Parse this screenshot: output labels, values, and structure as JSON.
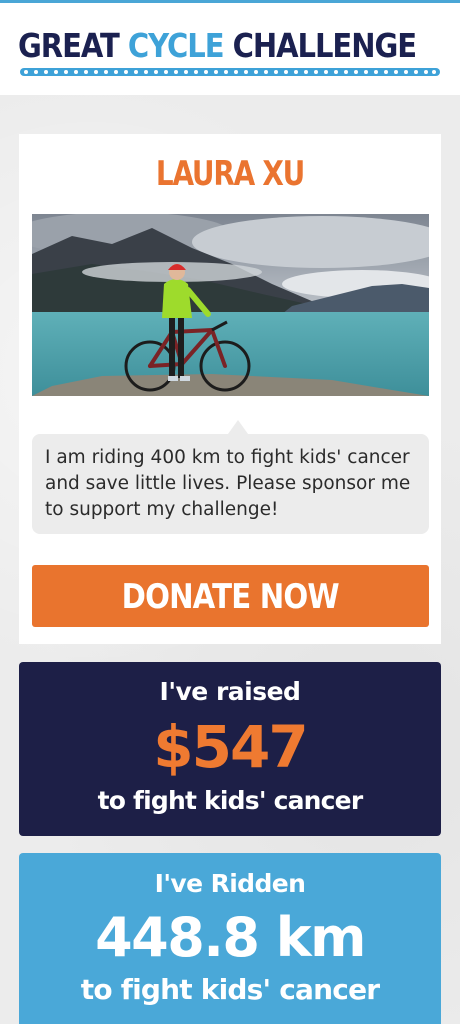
{
  "header": {
    "logo_word1": "GREAT",
    "logo_word2": "CYCLE",
    "logo_word3": "CHALLENGE",
    "logo_colors": {
      "navy": "#1b2150",
      "blue": "#3ea2d8"
    }
  },
  "profile": {
    "name": "LAURA XU",
    "photo_icon": "cyclist-photo",
    "message": "I am riding 400 km to fight kids' cancer and save little lives. Please sponsor me to support my challenge!",
    "donate_label": "DONATE NOW"
  },
  "raised": {
    "label": "I've raised",
    "amount": "$547",
    "caption": "to fight kids' cancer"
  },
  "ridden": {
    "label": "I've Ridden",
    "distance": "448.8 km",
    "caption": "to fight kids' cancer"
  },
  "colors": {
    "accent_orange": "#e9742e",
    "navy": "#1d1f47",
    "sky_blue": "#4aa8d8"
  }
}
